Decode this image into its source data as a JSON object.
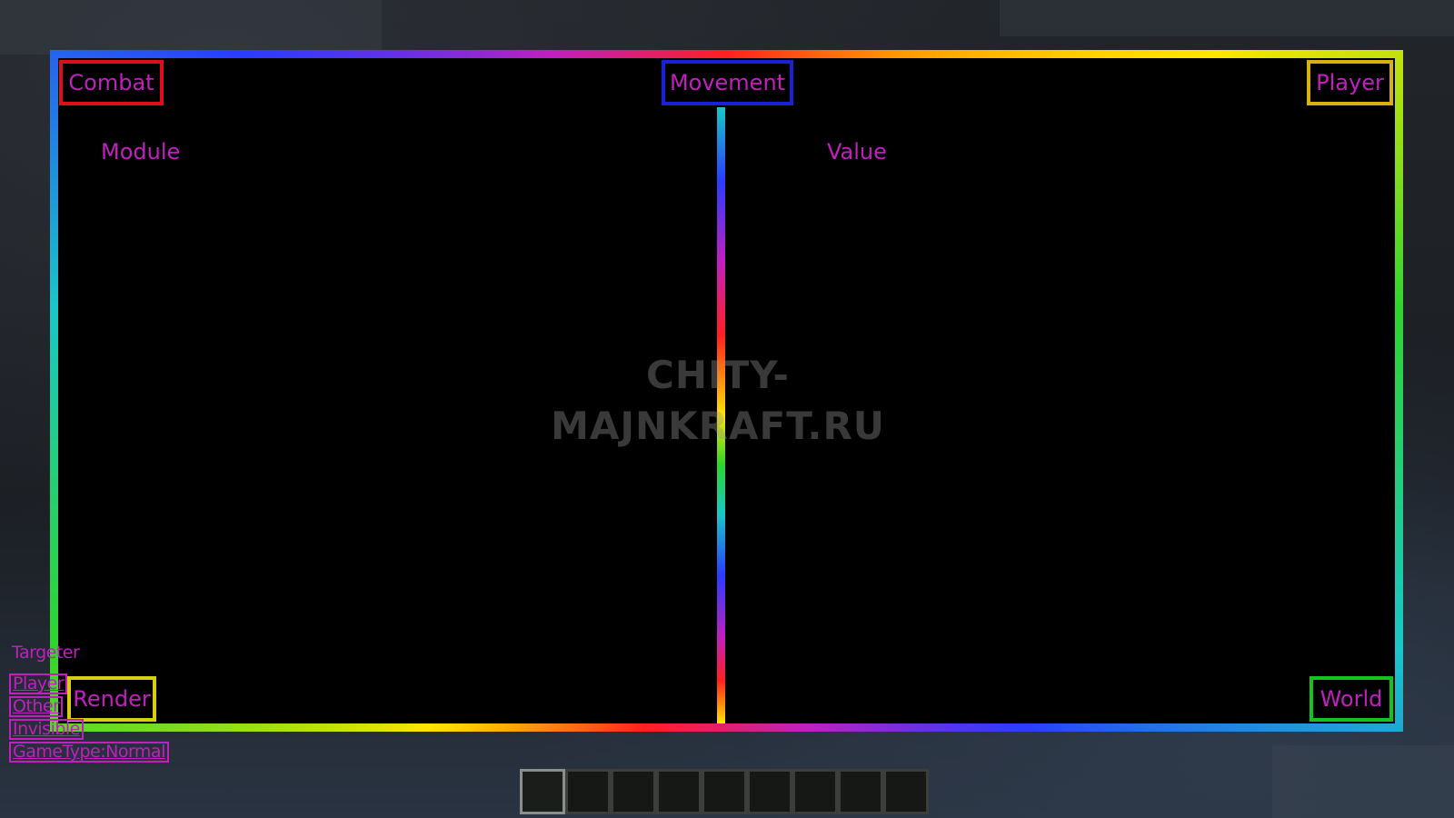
{
  "categories": {
    "combat": "Combat",
    "movement": "Movement",
    "player": "Player",
    "render": "Render",
    "world": "World"
  },
  "columns": {
    "module": "Module",
    "value": "Value"
  },
  "watermark": {
    "line1": "CHITY-",
    "line2": "MAJNKRAFT.RU"
  },
  "targeter": {
    "title": "Targeter",
    "options": [
      "Player",
      "Other",
      "Invisible",
      "GameType:Normal"
    ]
  },
  "hotbar": {
    "slot_count": 9,
    "selected_slot": 1
  },
  "colors": {
    "text_accent": "#c21fbf",
    "combat_border": "#e00d1c",
    "movement_border": "#1a22d8",
    "player_border": "#d9b00c",
    "render_border": "#d6cf10",
    "world_border": "#14c41a"
  }
}
